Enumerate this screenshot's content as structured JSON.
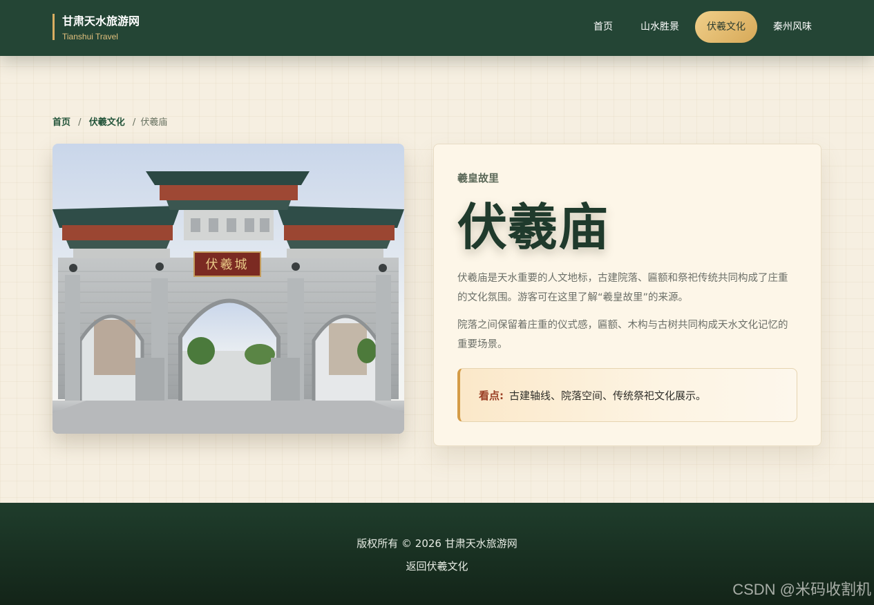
{
  "header": {
    "brand_title": "甘肃天水旅游网",
    "brand_subtitle": "Tianshui Travel",
    "nav": [
      {
        "label": "首页",
        "active": false
      },
      {
        "label": "山水胜景",
        "active": false
      },
      {
        "label": "伏羲文化",
        "active": true
      },
      {
        "label": "秦州风味",
        "active": false
      }
    ]
  },
  "breadcrumb": {
    "home": "首页",
    "separator": "/",
    "section": "伏羲文化",
    "current": "伏羲庙"
  },
  "photo": {
    "plaque_text": "伏羲城",
    "icon": "memorial-gate-photo"
  },
  "card": {
    "eyebrow": "羲皇故里",
    "title": "伏羲庙",
    "paragraph1": "伏羲庙是天水重要的人文地标，古建院落、匾额和祭祀传统共同构成了庄重的文化氛围。游客可在这里了解“羲皇故里”的来源。",
    "paragraph2": "院落之间保留着庄重的仪式感，匾额、木构与古树共同构成天水文化记忆的重要场景。",
    "highlight_label": "看点:",
    "highlight_text": "古建轴线、院落空间、传统祭祀文化展示。"
  },
  "footer": {
    "copyright": "版权所有 © 2026 甘肃天水旅游网",
    "back_link": "返回伏羲文化",
    "watermark": "CSDN @米码收割机"
  },
  "colors": {
    "header_bg": "#244535",
    "accent_gold": "#d9ae62",
    "title_green": "#1f3a2c",
    "highlight_red": "#9a3f24"
  }
}
